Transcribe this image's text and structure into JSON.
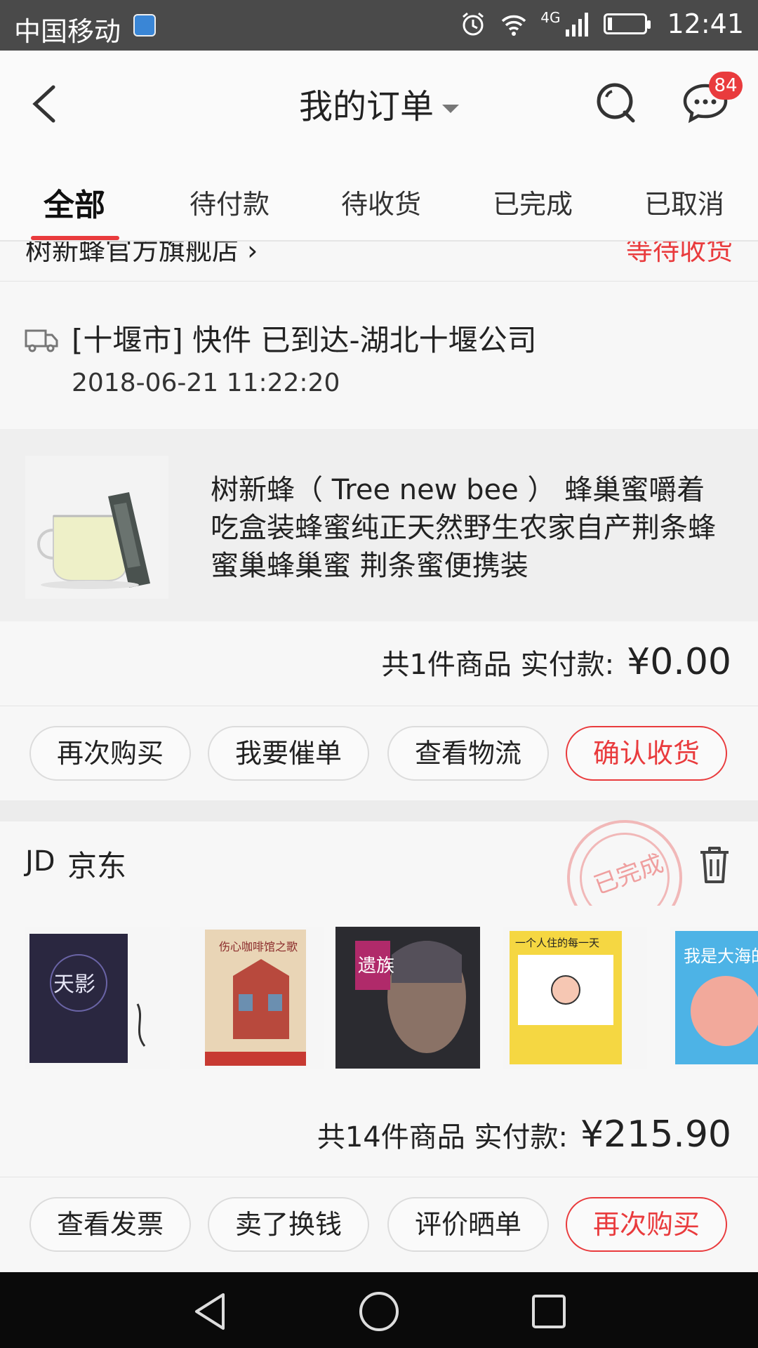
{
  "status_bar": {
    "carrier": "中国移动",
    "network": "4G",
    "time": "12:41"
  },
  "header": {
    "title": "我的订单",
    "message_badge": "84"
  },
  "tabs": [
    {
      "label": "全部",
      "active": true
    },
    {
      "label": "待付款",
      "active": false
    },
    {
      "label": "待收货",
      "active": false
    },
    {
      "label": "已完成",
      "active": false
    },
    {
      "label": "已取消",
      "active": false
    }
  ],
  "order1": {
    "store_name_partial": "树新蜂官方旗舰店 ›",
    "status": "等待收货",
    "logistics": {
      "text": "[十堰市] 快件 已到达-湖北十堰公司",
      "time": "2018-06-21 11:22:20"
    },
    "product_name": "树新蜂（ Tree new bee ） 蜂巢蜜嚼着吃盒装蜂蜜纯正天然野生农家自产荆条蜂蜜巢蜂巢蜜 荆条蜜便携装",
    "summary_count": "共1件商品  实付款:",
    "summary_price": "¥0.00",
    "buttons": [
      "再次购买",
      "我要催单",
      "查看物流",
      "确认收货"
    ]
  },
  "order2": {
    "logo": "JD",
    "store_name": "京东",
    "stamp": "已完成",
    "books": [
      {
        "title": "天影",
        "color": "#2a2740"
      },
      {
        "title": "伤心咖啡馆之歌",
        "color": "#e9d5b6"
      },
      {
        "title": "遗族",
        "color": "#2b2b30"
      },
      {
        "title": "一个人住的每一天",
        "color": "#f5d742"
      },
      {
        "title": "我是大海的男孩",
        "color": "#4db3e6"
      }
    ],
    "summary_count": "共14件商品  实付款:",
    "summary_price": "¥215.90",
    "buttons": [
      "查看发票",
      "卖了换钱",
      "评价晒单",
      "再次购买"
    ]
  }
}
